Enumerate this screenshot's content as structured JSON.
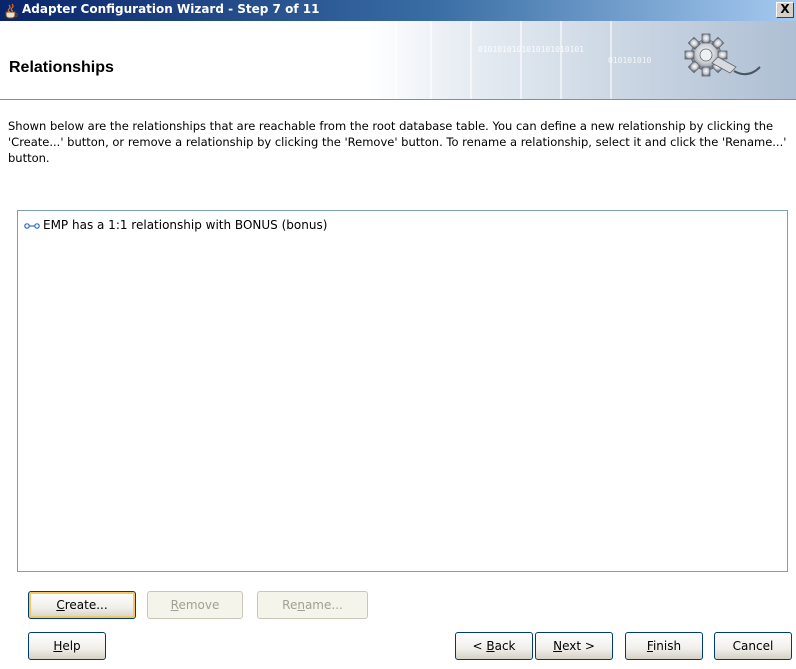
{
  "window": {
    "title": "Adapter Configuration Wizard - Step 7 of 11",
    "close_label": "X"
  },
  "banner": {
    "page_title": "Relationships",
    "binary_text": "0101010101010101010101",
    "binary_text_2": "010101010"
  },
  "description": "Shown below are the relationships that are reachable from the root database table.  You can define a new relationship by clicking the 'Create...' button, or remove a relationship by clicking the 'Remove' button.  To rename a relationship, select it and click the 'Rename...' button.",
  "relationships": [
    {
      "label": "EMP has a 1:1 relationship with BONUS (bonus)",
      "icon": "relationship-icon"
    }
  ],
  "list_buttons": {
    "create": {
      "pre": "",
      "mnemonic": "C",
      "post": "reate..."
    },
    "remove": {
      "pre": "",
      "mnemonic": "R",
      "post": "emove"
    },
    "rename": {
      "pre": "Re",
      "mnemonic": "n",
      "post": "ame..."
    }
  },
  "footer_buttons": {
    "help": {
      "pre": "",
      "mnemonic": "H",
      "post": "elp"
    },
    "back": {
      "pre": "< ",
      "mnemonic": "B",
      "post": "ack"
    },
    "next": {
      "pre": "",
      "mnemonic": "N",
      "post": "ext >"
    },
    "finish": {
      "pre": "",
      "mnemonic": "F",
      "post": "inish"
    },
    "cancel": {
      "pre": "Cancel",
      "mnemonic": "",
      "post": ""
    }
  },
  "colors": {
    "titlebar_start": "#0a246a",
    "titlebar_end": "#a6caf0",
    "disabled_text": "#a1a192",
    "list_border": "#7f9db9"
  }
}
